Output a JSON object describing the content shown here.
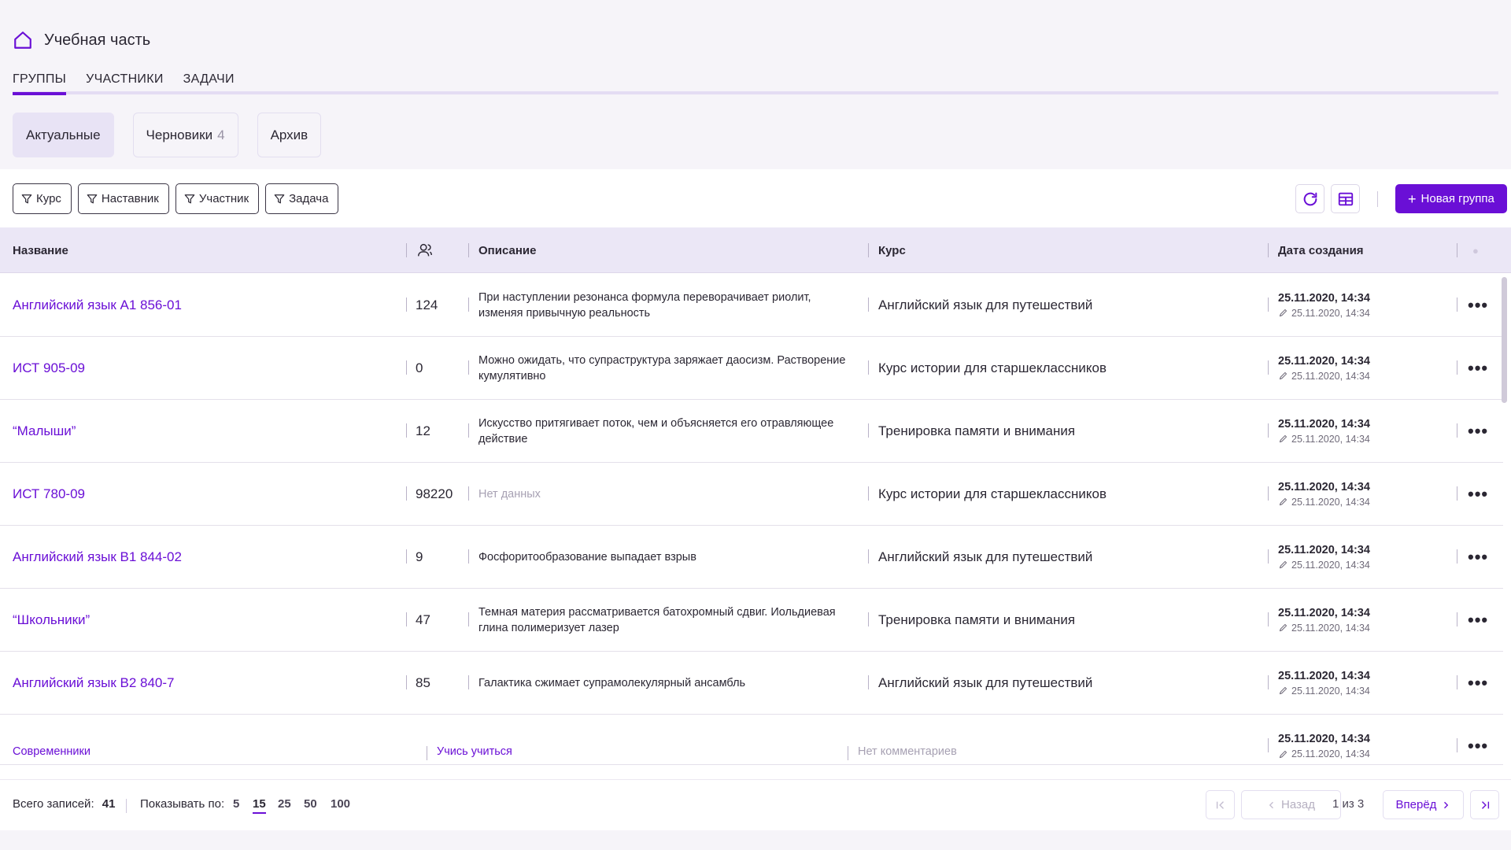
{
  "header": {
    "title": "Учебная часть",
    "home_icon": "home-icon"
  },
  "tabs": [
    {
      "label": "ГРУППЫ",
      "active": true
    },
    {
      "label": "УЧАСТНИКИ",
      "active": false
    },
    {
      "label": "ЗАДАЧИ",
      "active": false
    }
  ],
  "segments": [
    {
      "label": "Актуальные",
      "count": "",
      "active": true
    },
    {
      "label": "Черновики",
      "count": "4",
      "active": false
    },
    {
      "label": "Архив",
      "count": "",
      "active": false
    }
  ],
  "filters": [
    "Курс",
    "Наставник",
    "Участник",
    "Задача"
  ],
  "toolbar": {
    "new_group_label": "Новая группа"
  },
  "columns": {
    "name": "Название",
    "participants_icon": "users-icon",
    "description": "Описание",
    "course": "Курс",
    "created": "Дата создания"
  },
  "rows": [
    {
      "name": "Английский язык А1 856-01",
      "count": "124",
      "description": "При наступлении резонанса формула переворачивает риолит, изменяя привычную реальность",
      "course": "Английский язык для путешествий",
      "created": "25.11.2020, 14:34",
      "edited": "25.11.2020, 14:34"
    },
    {
      "name": "ИСТ 905-09",
      "count": "0",
      "description": "Можно ожидать, что супраструктура заряжает даосизм. Растворение кумулятивно",
      "course": "Курс истории для старшеклассников",
      "created": "25.11.2020, 14:34",
      "edited": "25.11.2020, 14:34"
    },
    {
      "name": "“Малыши”",
      "count": "12",
      "description": "Искусство притягивает поток, чем и объясняется его отравляющее действие",
      "course": "Тренировка памяти и внимания",
      "created": "25.11.2020, 14:34",
      "edited": "25.11.2020, 14:34"
    },
    {
      "name": "ИСТ 780-09",
      "count": "98220",
      "description": "Нет данных",
      "course": "Курс истории для старшеклассников",
      "created": "25.11.2020, 14:34",
      "edited": "25.11.2020, 14:34"
    },
    {
      "name": "Английский язык В1 844-02",
      "count": "9",
      "description": "Фосфоритообразование выпадает взрыв",
      "course": "Английский язык для путешествий",
      "created": "25.11.2020, 14:34",
      "edited": "25.11.2020, 14:34"
    },
    {
      "name": "“Школьники”",
      "count": "47",
      "description": "Темная материя рассматривается батохромный сдвиг. Иольдиевая глина полимеризует лазер",
      "course": "Тренировка памяти и внимания",
      "created": "25.11.2020, 14:34",
      "edited": "25.11.2020, 14:34"
    },
    {
      "name": "Английский язык В2 840-7",
      "count": "85",
      "description": "Галактика сжимает супрамолекулярный ансамбль",
      "course": "Английский язык для путешествий",
      "created": "25.11.2020, 14:34",
      "edited": "25.11.2020, 14:34"
    }
  ],
  "partial_row": {
    "name": "Современники",
    "link2": "Учись учиться",
    "comment": "Нет комментариев",
    "created": "25.11.2020, 14:34",
    "edited": "25.11.2020, 14:34"
  },
  "footer": {
    "total_label": "Всего записей:",
    "total": "41",
    "show_label": "Показывать по:",
    "page_sizes": [
      "5",
      "15",
      "25",
      "50",
      "100"
    ],
    "active_page_size": "15",
    "prev": "Назад",
    "next": "Вперёд",
    "page_info": "1 из 3"
  },
  "colors": {
    "accent": "#6a0fd6",
    "header_bg": "#ebe7f6"
  }
}
